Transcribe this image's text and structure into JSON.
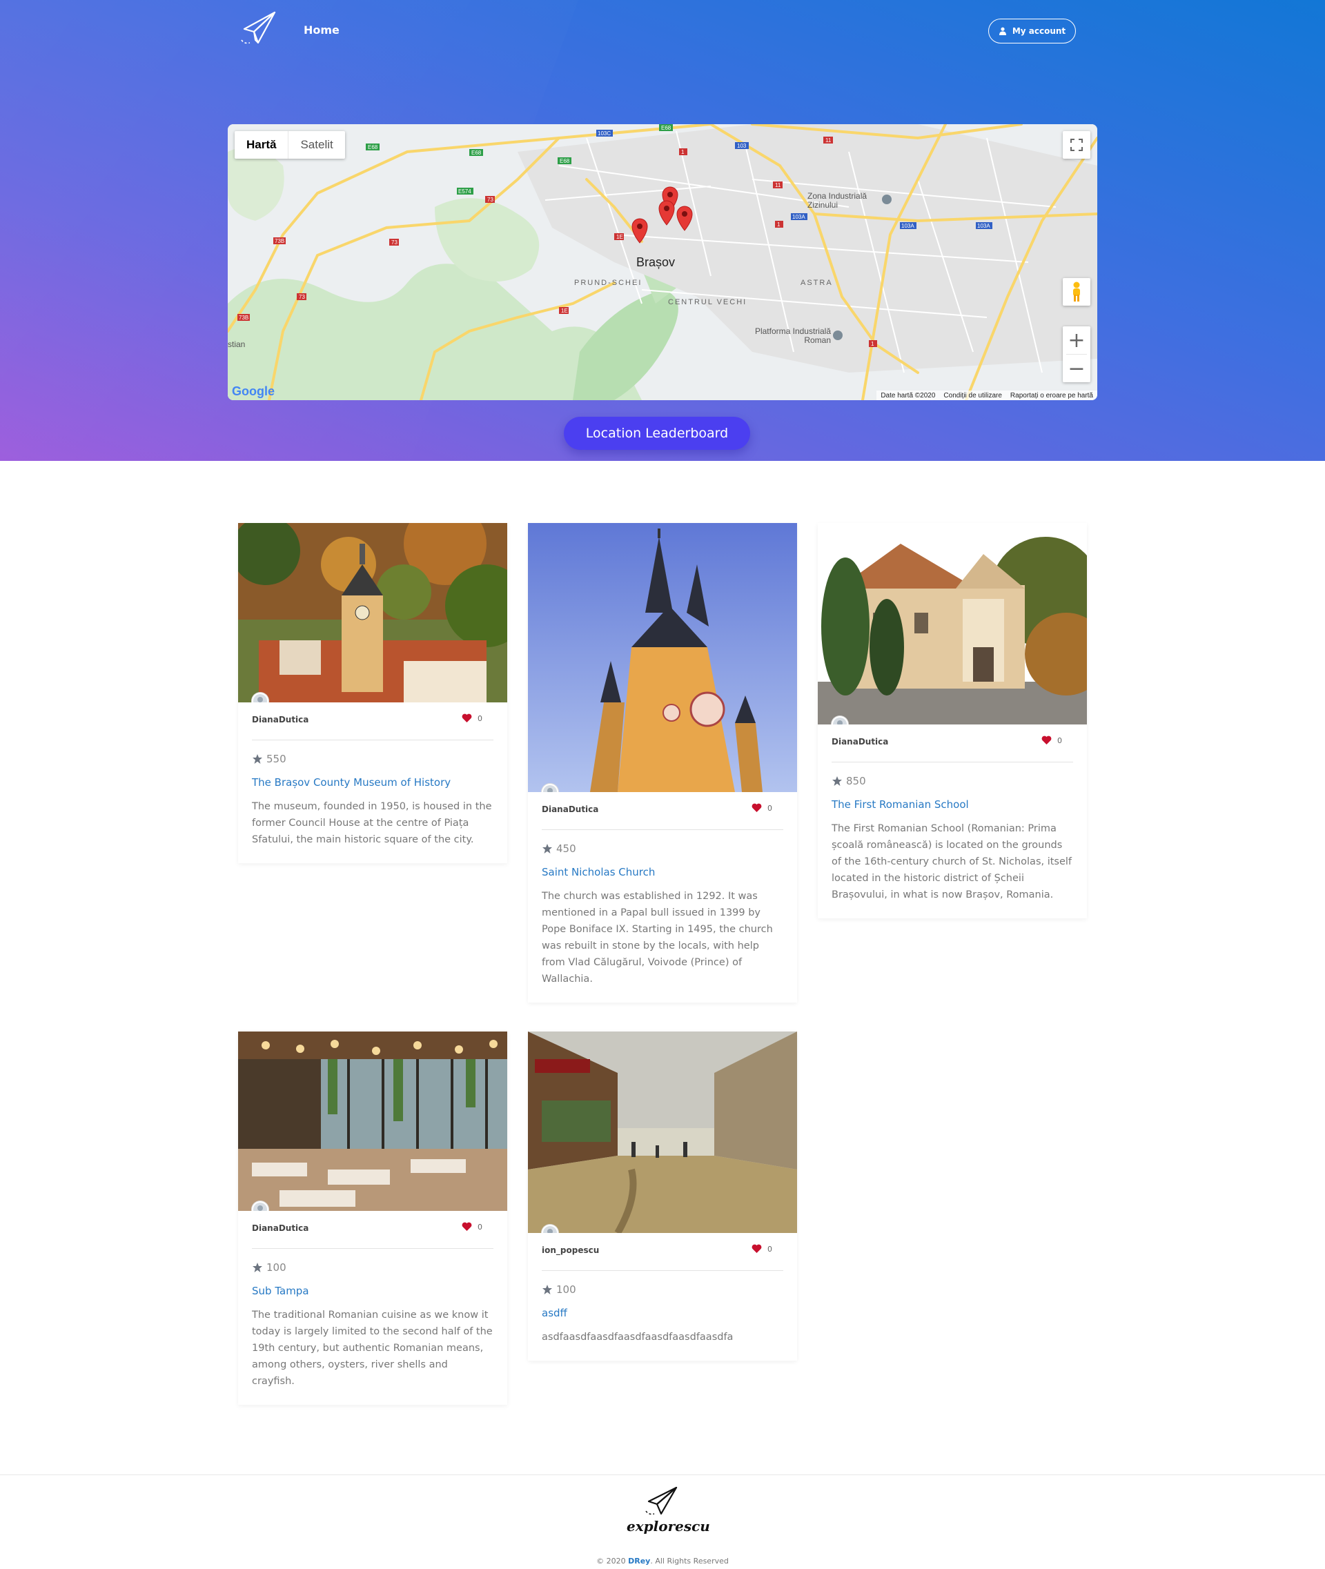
{
  "nav": {
    "home": "Home",
    "account": "My account"
  },
  "map": {
    "type_map": "Hartă",
    "type_satellite": "Satelit",
    "city": "Brașov",
    "labels": {
      "zona": "Zona Industrială Zizinului",
      "platforma": "Platforma Industrială Roman",
      "prund": "PRUND-SCHEI",
      "centru": "CENTRUL VECHI",
      "astra": "ASTRA",
      "stian": "stian"
    },
    "google": "Google",
    "footer_data": "Date hartă ©2020",
    "footer_terms": "Condiții de utilizare",
    "footer_report": "Raportați o eroare pe hartă"
  },
  "leaderboard": "Location Leaderboard",
  "cards": [
    {
      "user": "DianaDutica",
      "likes": "0",
      "rating": "550",
      "title": "The Brașov County Museum of History",
      "desc": "The museum, founded in 1950, is housed in the former Council House at the centre of Piața Sfatului, the main historic square of the city."
    },
    {
      "user": "DianaDutica",
      "likes": "0",
      "rating": "450",
      "title": "Saint Nicholas Church",
      "desc": "The church was established in 1292. It was mentioned in a Papal bull issued in 1399 by Pope Boniface IX. Starting in 1495, the church was rebuilt in stone by the locals, with help from Vlad Călugărul, Voivode (Prince) of Wallachia."
    },
    {
      "user": "DianaDutica",
      "likes": "0",
      "rating": "850",
      "title": "The First Romanian School",
      "desc": "The First Romanian School (Romanian: Prima școală românească) is located on the grounds of the 16th-century church of St. Nicholas, itself located in the historic district of Șcheii Brașovului, in what is now Brașov, Romania."
    },
    {
      "user": "DianaDutica",
      "likes": "0",
      "rating": "100",
      "title": "Sub Tampa",
      "desc": "The traditional Romanian cuisine as we know it today is largely limited to the second half of the 19th century, but authentic Romanian means, among others, oysters, river shells and crayfish."
    },
    {
      "user": "ion_popescu",
      "likes": "0",
      "rating": "100",
      "title": "asdff",
      "desc": "asdfaasdfaasdfaasdfaasdfaasdfaasdfa"
    }
  ],
  "footer": {
    "brand": "explorescu",
    "copyright_prefix": "© 2020 ",
    "copyright_name": "DRey",
    "copyright_suffix": ". All Rights Reserved"
  },
  "colors": {
    "accent": "#4b3ff0",
    "link": "#2779c4",
    "heart": "#c8102e"
  }
}
